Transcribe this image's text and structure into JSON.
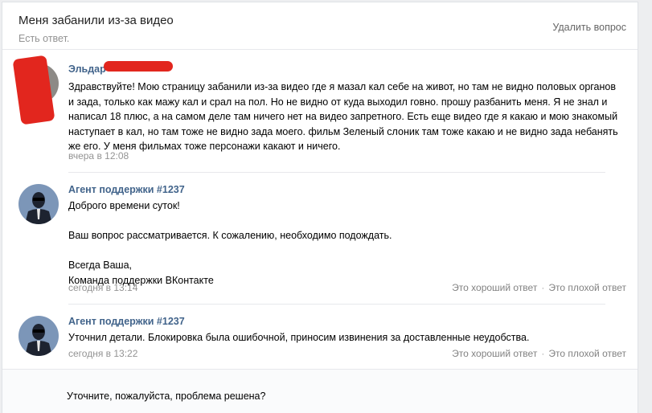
{
  "header": {
    "title": "Меня забанили из-за видео",
    "status": "Есть ответ.",
    "delete_label": "Удалить вопрос"
  },
  "messages": [
    {
      "author": "Эльдар",
      "text": "Здравствуйте! Мою страницу забанили из-за видео где я мазал кал себе на живот, но там не видно половых органов\nи зада, только как мажу кал и срал на пол. Но не видно от куда выходил говно. прошу разбанить меня. Я не знал и\nнаписал 18 плюс, а на самом деле там ничего нет на видео запретного. Есть еще видео где я какаю и мою знакомый\nнаступает в кал, но там тоже не видно зада моего. фильм Зеленый слоник там тоже какаю и не видно зада небанять\nже его. У меня фильмах тоже персонажи какают и ничего.",
      "time": "вчера в 12:08"
    },
    {
      "author": "Агент поддержки #1237",
      "text": "Доброго времени суток!\n\nВаш вопрос рассматривается. К сожалению, необходимо подождать.\n\nВсегда Ваша,\nКоманда поддержки ВКонтакте",
      "time": "сегодня в 13:14",
      "good_label": "Это хороший ответ",
      "bad_label": "Это плохой ответ",
      "separator": "·"
    },
    {
      "author": "Агент поддержки #1237",
      "text": "Уточнил детали. Блокировка была ошибочной, приносим извинения за доставленные неудобства.",
      "time": "сегодня в 13:22",
      "good_label": "Это хороший ответ",
      "bad_label": "Это плохой ответ",
      "separator": "·"
    }
  ],
  "footer": {
    "prompt": "Уточните, пожалуйста, проблема решена?"
  },
  "colors": {
    "link": "#42648b",
    "muted": "#939393",
    "redaction": "#e2261e"
  }
}
